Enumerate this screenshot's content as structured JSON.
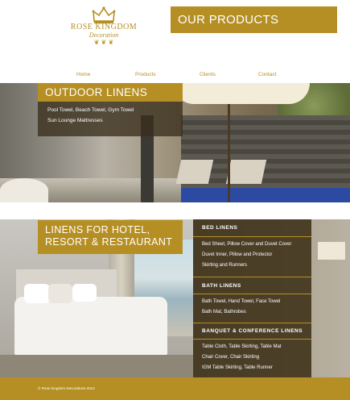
{
  "brand": {
    "name": "ROSE KINGDOM",
    "subtitle": "Decoration",
    "ornament": "❦ ❦ ❦",
    "color": "#b58f24"
  },
  "header": {
    "page_title": "OUR PRODUCTS"
  },
  "nav": {
    "items": [
      {
        "label": "Home"
      },
      {
        "label": "Products"
      },
      {
        "label": "Clients"
      },
      {
        "label": "Contact"
      }
    ]
  },
  "outdoor": {
    "title": "OUTDOOR LINENS",
    "lines": [
      "Pool Towel, Beach Towel, Gym Towel",
      "Sun Lounge Mattresses"
    ]
  },
  "hotel": {
    "title_lines": [
      "LINENS FOR HOTEL,",
      "RESORT & RESTAURANT"
    ],
    "sections": [
      {
        "heading": "BED LINENS",
        "lines": [
          "Bed Sheet, Pillow Cover and Duvet Cover",
          "Duvet Inner, Pillow and Protector",
          "Skirting and Runners"
        ]
      },
      {
        "heading": "BATH LINENS",
        "lines": [
          "Bath Towel, Hand Towel, Face Towel",
          "Bath Mat, Bathrobes"
        ]
      },
      {
        "heading": "BANQUET & CONFERENCE LINENS",
        "lines": [
          "Table Cloth, Table Skirting, Table Mat",
          "Chair Cover, Chair Skirting",
          "IGM Table Skirting, Table Runner"
        ]
      }
    ]
  },
  "footer": {
    "copyright": "© Rose Kingdom Decorations 2013"
  }
}
